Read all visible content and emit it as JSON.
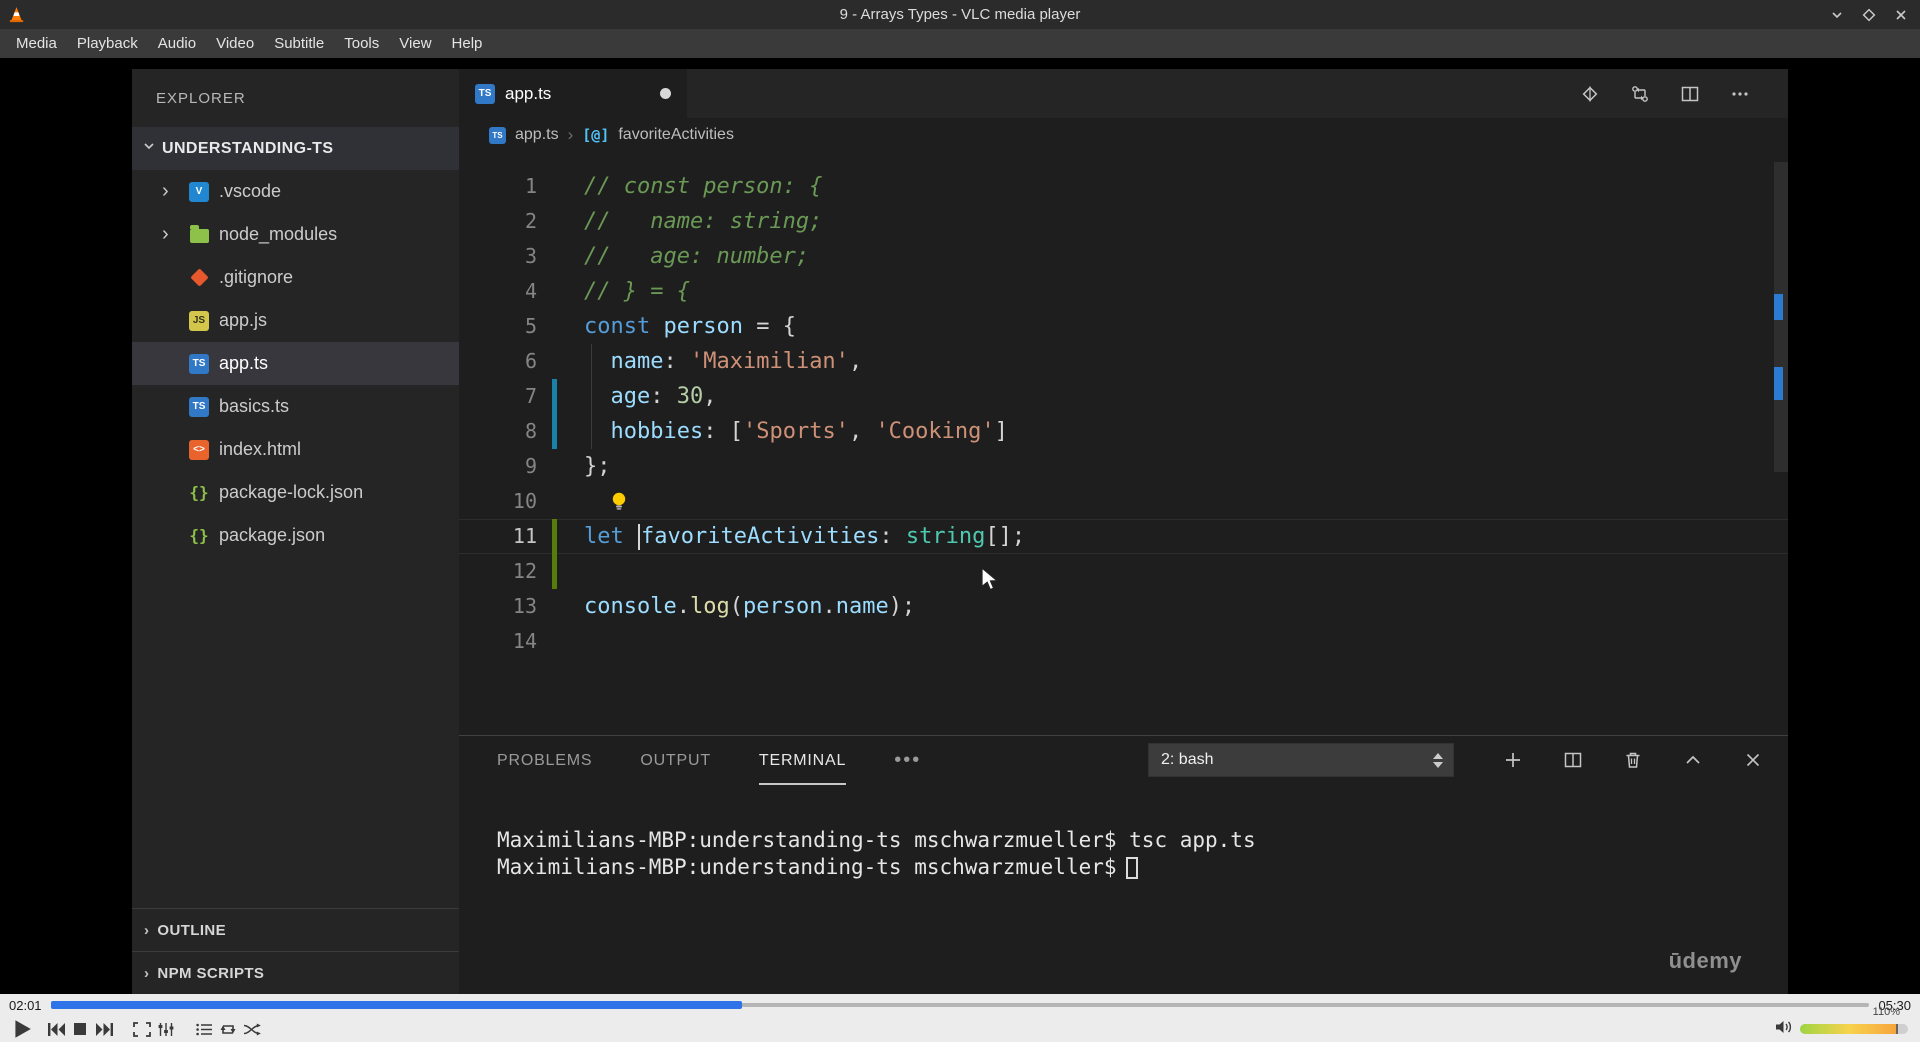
{
  "vlc": {
    "window_title": "9 - Arrays Types - VLC media player",
    "menu_items": [
      "Media",
      "Playback",
      "Audio",
      "Video",
      "Subtitle",
      "Tools",
      "View",
      "Help"
    ],
    "elapsed": "02:01",
    "remaining": "05:30",
    "progress_pct": 38,
    "volume_label": "110%",
    "volume_pct": 90
  },
  "vscode": {
    "explorer": {
      "title": "EXPLORER",
      "root": "UNDERSTANDING-TS",
      "items": [
        {
          "label": ".vscode",
          "icon": "vscode",
          "expandable": true
        },
        {
          "label": "node_modules",
          "icon": "folder-node",
          "expandable": true
        },
        {
          "label": ".gitignore",
          "icon": "git",
          "expandable": false
        },
        {
          "label": "app.js",
          "icon": "js",
          "expandable": false
        },
        {
          "label": "app.ts",
          "icon": "ts",
          "expandable": false,
          "selected": true
        },
        {
          "label": "basics.ts",
          "icon": "ts",
          "expandable": false
        },
        {
          "label": "index.html",
          "icon": "html",
          "expandable": false
        },
        {
          "label": "package-lock.json",
          "icon": "json",
          "expandable": false
        },
        {
          "label": "package.json",
          "icon": "json",
          "expandable": false
        }
      ],
      "sections": [
        {
          "label": "OUTLINE"
        },
        {
          "label": "NPM SCRIPTS"
        }
      ]
    },
    "editor": {
      "tab_label": "app.ts",
      "tab_modified": true,
      "breadcrumb_file": "app.ts",
      "breadcrumb_symbol": "favoriteActivities"
    },
    "code": {
      "lines": [
        {
          "n": 1,
          "tokens": [
            {
              "c": "cmt",
              "t": "// const person: {"
            }
          ]
        },
        {
          "n": 2,
          "tokens": [
            {
              "c": "cmt",
              "t": "//   name: string;"
            }
          ]
        },
        {
          "n": 3,
          "tokens": [
            {
              "c": "cmt",
              "t": "//   age: number;"
            }
          ]
        },
        {
          "n": 4,
          "tokens": [
            {
              "c": "cmt",
              "t": "// } = {"
            }
          ]
        },
        {
          "n": 5,
          "tokens": [
            {
              "c": "kw",
              "t": "const"
            },
            {
              "c": "var",
              "t": " person"
            },
            {
              "c": "pun",
              "t": " = {"
            }
          ]
        },
        {
          "n": 6,
          "guide": true,
          "tokens": [
            {
              "c": "var",
              "t": "  name"
            },
            {
              "c": "pun",
              "t": ": "
            },
            {
              "c": "str",
              "t": "'Maximilian'"
            },
            {
              "c": "pun",
              "t": ","
            }
          ]
        },
        {
          "n": 7,
          "guide": true,
          "gutter": "mod",
          "tokens": [
            {
              "c": "var",
              "t": "  age"
            },
            {
              "c": "pun",
              "t": ": "
            },
            {
              "c": "num",
              "t": "30"
            },
            {
              "c": "pun",
              "t": ","
            }
          ]
        },
        {
          "n": 8,
          "guide": true,
          "gutter": "mod",
          "tokens": [
            {
              "c": "var",
              "t": "  hobbies"
            },
            {
              "c": "pun",
              "t": ": ["
            },
            {
              "c": "str",
              "t": "'Sports'"
            },
            {
              "c": "pun",
              "t": ", "
            },
            {
              "c": "str",
              "t": "'Cooking'"
            },
            {
              "c": "pun",
              "t": "]"
            }
          ]
        },
        {
          "n": 9,
          "tokens": [
            {
              "c": "pun",
              "t": "};"
            }
          ]
        },
        {
          "n": 10,
          "lightbulb": true,
          "tokens": []
        },
        {
          "n": 11,
          "current": true,
          "gutter": "add",
          "caret_at": 1,
          "tokens": [
            {
              "c": "kw",
              "t": "let "
            },
            {
              "c": "var",
              "t": "favoriteActivities"
            },
            {
              "c": "pun",
              "t": ": "
            },
            {
              "c": "typ",
              "t": "string"
            },
            {
              "c": "pun",
              "t": "[];"
            }
          ]
        },
        {
          "n": 12,
          "gutter": "add",
          "tokens": []
        },
        {
          "n": 13,
          "tokens": [
            {
              "c": "var",
              "t": "console"
            },
            {
              "c": "pun",
              "t": "."
            },
            {
              "c": "fn",
              "t": "log"
            },
            {
              "c": "pun",
              "t": "("
            },
            {
              "c": "var",
              "t": "person"
            },
            {
              "c": "pun",
              "t": "."
            },
            {
              "c": "var",
              "t": "name"
            },
            {
              "c": "pun",
              "t": ");"
            }
          ]
        },
        {
          "n": 14,
          "tokens": []
        }
      ]
    },
    "panel": {
      "tabs": [
        {
          "label": "PROBLEMS",
          "active": false
        },
        {
          "label": "OUTPUT",
          "active": false
        },
        {
          "label": "TERMINAL",
          "active": true
        }
      ],
      "shell": "2: bash",
      "terminal_lines": [
        {
          "text": "Maximilians-MBP:understanding-ts mschwarzmueller$ tsc app.ts",
          "cursor": false
        },
        {
          "text": "Maximilians-MBP:understanding-ts mschwarzmueller$",
          "cursor": true
        }
      ]
    },
    "watermark": "ūdemy"
  },
  "colors": {
    "progress_blue": "#2e73e8",
    "ts_icon_blue": "#3178c6",
    "selection_gray": "#37373d",
    "comment_green": "#6a9955",
    "keyword_blue": "#569cd6",
    "string_orange": "#ce9178",
    "type_teal": "#4ec9b0",
    "added_gutter_green": "#587c0c",
    "modified_gutter_blue": "#1b81a8"
  }
}
